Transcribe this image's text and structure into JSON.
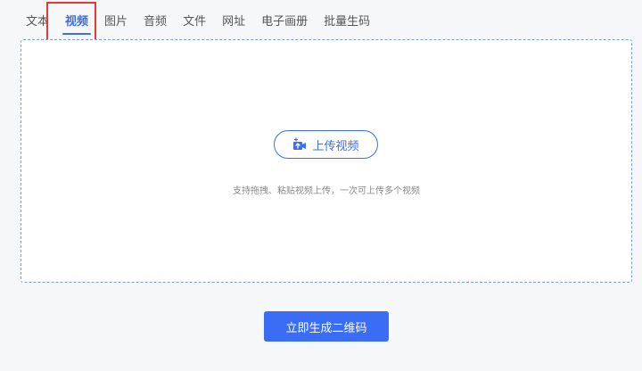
{
  "tabs": [
    {
      "label": "文本",
      "active": false
    },
    {
      "label": "视频",
      "active": true
    },
    {
      "label": "图片",
      "active": false
    },
    {
      "label": "音频",
      "active": false
    },
    {
      "label": "文件",
      "active": false
    },
    {
      "label": "网址",
      "active": false
    },
    {
      "label": "电子画册",
      "active": false
    },
    {
      "label": "批量生码",
      "active": false
    }
  ],
  "upload": {
    "button_label": "上传视频",
    "button_icon": "video-upload-icon",
    "hint": "支持拖拽、粘贴视频上传，一次可上传多个视频"
  },
  "actions": {
    "generate_label": "立即生成二维码"
  },
  "colors": {
    "accent": "#3b6cf6",
    "highlight": "#e53935",
    "background": "#f6f7f9"
  }
}
